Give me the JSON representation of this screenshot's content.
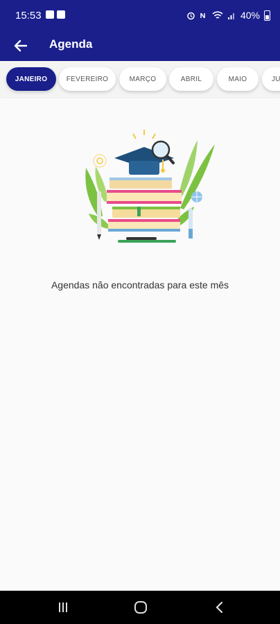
{
  "status_bar": {
    "time": "15:53",
    "battery": "40%"
  },
  "app_bar": {
    "title": "Agenda"
  },
  "months": [
    {
      "label": "JANEIRO",
      "active": true
    },
    {
      "label": "FEVEREIRO",
      "active": false
    },
    {
      "label": "MARÇO",
      "active": false
    },
    {
      "label": "ABRIL",
      "active": false
    },
    {
      "label": "MAIO",
      "active": false
    },
    {
      "label": "JU",
      "active": false
    }
  ],
  "empty_state": {
    "message": "Agendas não encontradas para este mês",
    "illustration": "books-graduation-cap-illustration"
  },
  "colors": {
    "primary": "#1a1f8c",
    "background": "#fafafa",
    "tab_background": "#ffffff",
    "text": "#333333"
  },
  "icons": {
    "back": "arrow-left-icon",
    "nav_recents": "recents-icon",
    "nav_home": "home-icon",
    "nav_back": "chevron-left-icon"
  }
}
